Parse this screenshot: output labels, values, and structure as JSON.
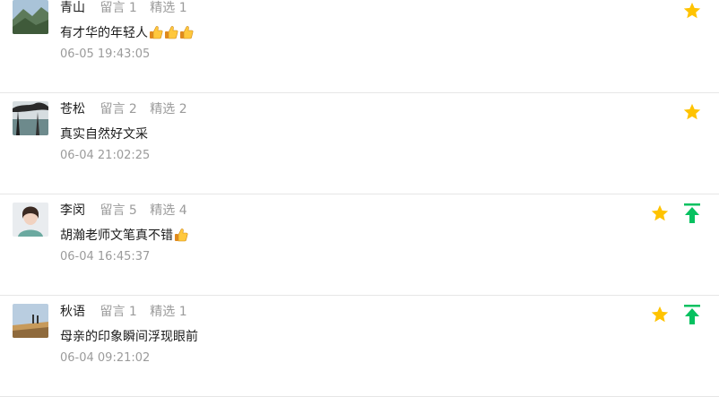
{
  "comments": [
    {
      "nickname": "青山",
      "message_label": "留言 1",
      "featured_label": "精选 1",
      "text": "有才华的年轻人",
      "thumbs": 3,
      "time": "06-05 19:43:05"
    },
    {
      "nickname": "苍松",
      "message_label": "留言 2",
      "featured_label": "精选 2",
      "text": "真实自然好文采",
      "thumbs": 0,
      "time": "06-04 21:02:25"
    },
    {
      "nickname": "李闵",
      "message_label": "留言 5",
      "featured_label": "精选 4",
      "text": "胡瀚老师文笔真不错",
      "thumbs": 1,
      "time": "06-04 16:45:37"
    },
    {
      "nickname": "秋语",
      "message_label": "留言 1",
      "featured_label": "精选 1",
      "text": "母亲的印象瞬间浮现眼前",
      "thumbs": 0,
      "time": "06-04 09:21:02"
    }
  ],
  "colors": {
    "star": "#ffc300",
    "pin_top": "#07c160",
    "meta_text": "#9b9b9b"
  },
  "icons": {
    "featured": "star-icon",
    "pin": "pin-top-icon",
    "emoji": "thumbs-up-emoji"
  }
}
